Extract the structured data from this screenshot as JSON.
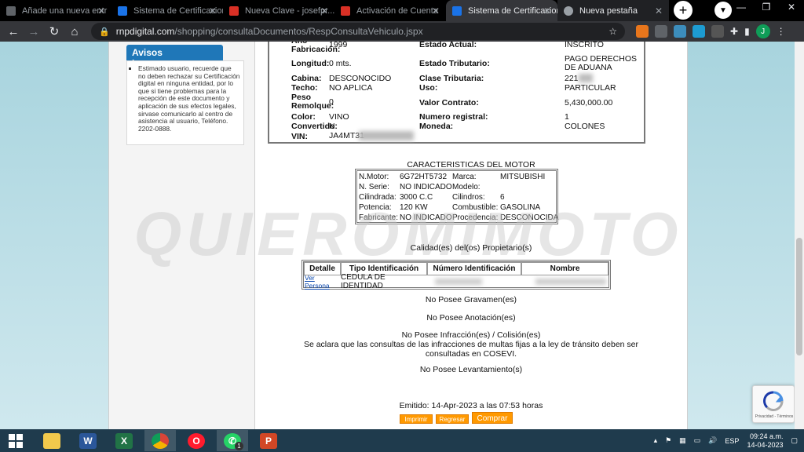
{
  "browser": {
    "tabs": [
      {
        "title": "Añade una nueva entr",
        "favicon_color": "#5f6368"
      },
      {
        "title": "Sistema de Certificaciones",
        "favicon_color": "#1a73e8"
      },
      {
        "title": "Nueva Clave - josefpr...",
        "favicon_color": "#d93025"
      },
      {
        "title": "Activación de Cuenta",
        "favicon_color": "#d93025"
      },
      {
        "title": "Sistema de Certificaciones",
        "favicon_color": "#1a73e8",
        "active": true
      },
      {
        "title": "Nueva pestaña",
        "favicon_color": "#9aa0a6"
      }
    ],
    "new_tab": "+",
    "url_domain": "rnpdigital.com",
    "url_path": "/shopping/consultaDocumentos/RespConsultaVehiculo.jspx",
    "profile_initial": "J"
  },
  "sidebar": {
    "heading": "Avisos importantes",
    "notice": "Estimado usuario, recuerde que no deben rechazar su Certificación digital en ninguna entidad, por lo que si tiene problemas para la recepción de este documento y aplicación de sus efectos legales, sirvase comunicarlo al centro de asistencia al usuario, Teléfono. 2202-0888."
  },
  "vehicle": {
    "fabricacion_label": "Año Fabricación:",
    "fabricacion": "1999",
    "longitud_label": "Longitud:",
    "longitud": "0 mts.",
    "cabina_label": "Cabina:",
    "cabina": "DESCONOCIDO",
    "techo_label": "Techo:",
    "techo": "NO APLICA",
    "peso_label": "Peso Remolque:",
    "peso": "0",
    "color_label": "Color:",
    "color": "VINO",
    "convertido_label": "Convertido:",
    "convertido": "N",
    "vin_label": "VIN:",
    "vin": "JA4MT31",
    "estado_label": "Estado Actual:",
    "estado": "INSCRITO",
    "tributario_label": "Estado Tributario:",
    "tributario": "PAGO DERECHOS DE ADUANA",
    "clase_label": "Clase Tributaria:",
    "clase": "221",
    "uso_label": "Uso:",
    "uso": "PARTICULAR",
    "valor_label": "Valor Contrato:",
    "valor": "5,430,000.00",
    "numreg_label": "Numero registral:",
    "numreg": "1",
    "moneda_label": "Moneda:",
    "moneda": "COLONES"
  },
  "motor": {
    "title": "CARACTERISTICAS DEL MOTOR",
    "rows": [
      {
        "l1": "N.Motor:",
        "v1": "6G72HT5732",
        "l2": "Marca:",
        "v2": "MITSUBISHI"
      },
      {
        "l1": "N. Serie:",
        "v1": "NO INDICADO",
        "l2": "Modelo:",
        "v2": ""
      },
      {
        "l1": "Cilindrada:",
        "v1": "3000 C.C",
        "l2": "Cilindros:",
        "v2": "6"
      },
      {
        "l1": "Potencia:",
        "v1": "120 KW",
        "l2": "Combustible:",
        "v2": "GASOLINA"
      },
      {
        "l1": "Fabricante:",
        "v1": "NO INDICADO",
        "l2": "Procedencia:",
        "v2": "DESCONOCIDA"
      }
    ]
  },
  "owners": {
    "title": "Calidad(es) del(os) Propietario(s)",
    "headers": [
      "Detalle",
      "Tipo Identificación",
      "Número Identificación",
      "Nombre"
    ],
    "row": {
      "link": "Ver Persona",
      "tipo": "CEDULA DE IDENTIDAD",
      "numero": "",
      "nombre": ""
    }
  },
  "notes": {
    "gravamen": "No Posee Gravamen(es)",
    "anotacion": "No Posee Anotación(es)",
    "infraccion": "No Posee Infracción(es) / Colisión(es)",
    "aclaracion": "Se aclara que las consultas de las infracciones de multas fijas a la ley de tránsito deben ser consultadas en COSEVI.",
    "levantamiento": "No Posee Levantamiento(s)",
    "emitido": "Emitido: 14-Apr-2023 a las 07:53 horas"
  },
  "buttons": {
    "imprimir": "Imprimir",
    "regresar": "Regresar",
    "comprar": "Comprar"
  },
  "watermark": "QUIEROMIMOTO",
  "recaptcha_terms": "Privacidad - Términos",
  "taskbar": {
    "apps": [
      "explorer",
      "word",
      "excel",
      "chrome",
      "opera",
      "whatsapp",
      "powerpoint"
    ],
    "whatsapp_badge": "1",
    "lang": "ESP",
    "time": "09:24 a.m.",
    "date": "14-04-2023"
  }
}
